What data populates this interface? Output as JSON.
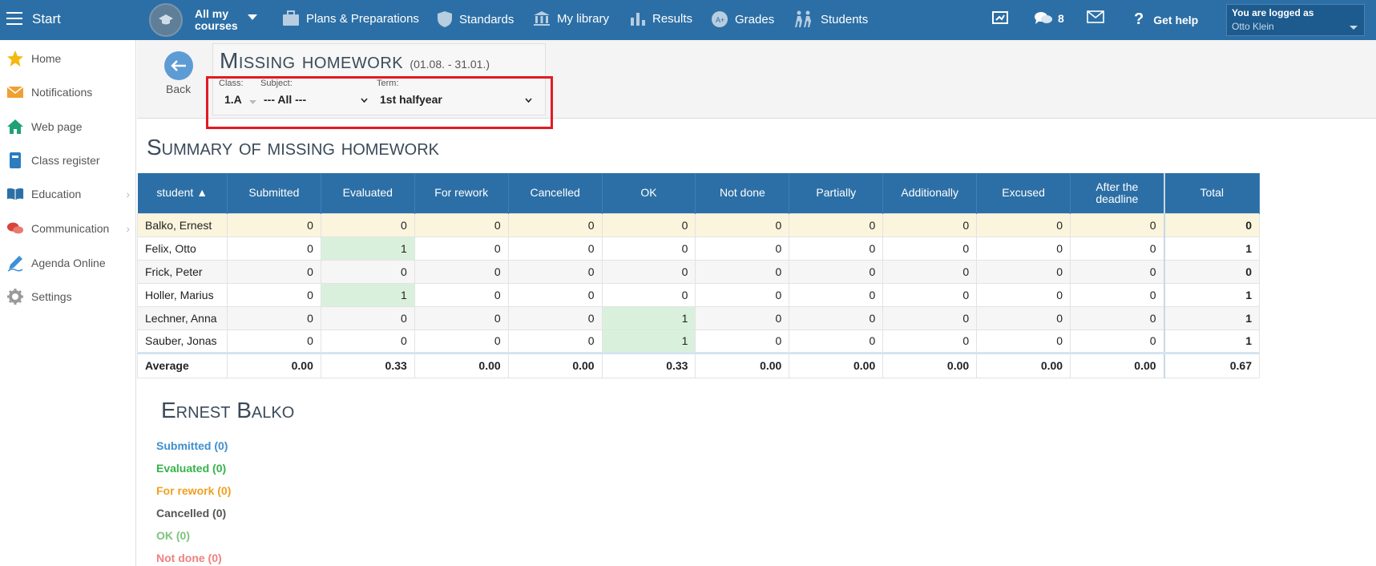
{
  "topbar": {
    "start": "Start",
    "courses": [
      "All my",
      "courses"
    ],
    "nav": [
      {
        "label": "Plans & Preparations",
        "icon": "briefcase-icon"
      },
      {
        "label": "Standards",
        "icon": "shield-icon"
      },
      {
        "label": "My library",
        "icon": "library-icon"
      },
      {
        "label": "Results",
        "icon": "bar-chart-icon"
      },
      {
        "label": "Grades",
        "icon": "grades-icon"
      },
      {
        "label": "Students",
        "icon": "students-icon"
      }
    ],
    "messages_count": "8",
    "help": "Get help",
    "logged_as": "You are logged as",
    "user": "Otto Klein"
  },
  "sidebar": {
    "items": [
      {
        "label": "Home",
        "icon": "star-icon",
        "color": "#f2b90f"
      },
      {
        "label": "Notifications",
        "icon": "envelope-icon",
        "color": "#f0a030"
      },
      {
        "label": "Web page",
        "icon": "house-icon",
        "color": "#20a078"
      },
      {
        "label": "Class register",
        "icon": "register-icon",
        "color": "#2c7cc0"
      },
      {
        "label": "Education",
        "icon": "book-icon",
        "color": "#2c6fa6"
      },
      {
        "label": "Communication",
        "icon": "chat-icon",
        "color": "#d9453a"
      },
      {
        "label": "Agenda Online",
        "icon": "pen-icon",
        "color": "#3f8fd8"
      },
      {
        "label": "Settings",
        "icon": "gear-icon",
        "color": "#9a9a9a"
      }
    ]
  },
  "header": {
    "back": "Back",
    "title": "Missing homework",
    "range": "(01.08. - 31.01.)",
    "filters": {
      "class_label": "Class:",
      "class_value": "1.A",
      "subject_label": "Subject:",
      "subject_value": "--- All ---",
      "term_label": "Term:",
      "term_value": "1st halfyear"
    }
  },
  "summary": {
    "title": "Summary of missing homework",
    "columns": [
      "student ▲",
      "Submitted",
      "Evaluated",
      "For rework",
      "Cancelled",
      "OK",
      "Not done",
      "Partially",
      "Additionally",
      "Excused",
      "After the deadline",
      "Total"
    ],
    "rows": [
      {
        "name": "Balko, Ernest",
        "values": [
          "0",
          "0",
          "0",
          "0",
          "0",
          "0",
          "0",
          "0",
          "0",
          "0",
          "0"
        ]
      },
      {
        "name": "Felix, Otto",
        "values": [
          "0",
          "1",
          "0",
          "0",
          "0",
          "0",
          "0",
          "0",
          "0",
          "0",
          "1"
        ]
      },
      {
        "name": "Frick, Peter",
        "values": [
          "0",
          "0",
          "0",
          "0",
          "0",
          "0",
          "0",
          "0",
          "0",
          "0",
          "0"
        ]
      },
      {
        "name": "Holler, Marius",
        "values": [
          "0",
          "1",
          "0",
          "0",
          "0",
          "0",
          "0",
          "0",
          "0",
          "0",
          "1"
        ]
      },
      {
        "name": "Lechner, Anna",
        "values": [
          "0",
          "0",
          "0",
          "0",
          "1",
          "0",
          "0",
          "0",
          "0",
          "0",
          "1"
        ]
      },
      {
        "name": "Sauber, Jonas",
        "values": [
          "0",
          "0",
          "0",
          "0",
          "1",
          "0",
          "0",
          "0",
          "0",
          "0",
          "1"
        ]
      }
    ],
    "average": {
      "name": "Average",
      "values": [
        "0.00",
        "0.33",
        "0.00",
        "0.00",
        "0.33",
        "0.00",
        "0.00",
        "0.00",
        "0.00",
        "0.00",
        "0.67"
      ]
    }
  },
  "student": {
    "title": "Ernest Balko",
    "stats": [
      {
        "label": "Submitted (0)",
        "color": "#3d8fd0"
      },
      {
        "label": "Evaluated (0)",
        "color": "#34b34a"
      },
      {
        "label": "For rework (0)",
        "color": "#f0a020"
      },
      {
        "label": "Cancelled (0)",
        "color": "#555555"
      },
      {
        "label": "OK (0)",
        "color": "#7cc37c"
      },
      {
        "label": "Not done (0)",
        "color": "#f08080"
      }
    ]
  }
}
